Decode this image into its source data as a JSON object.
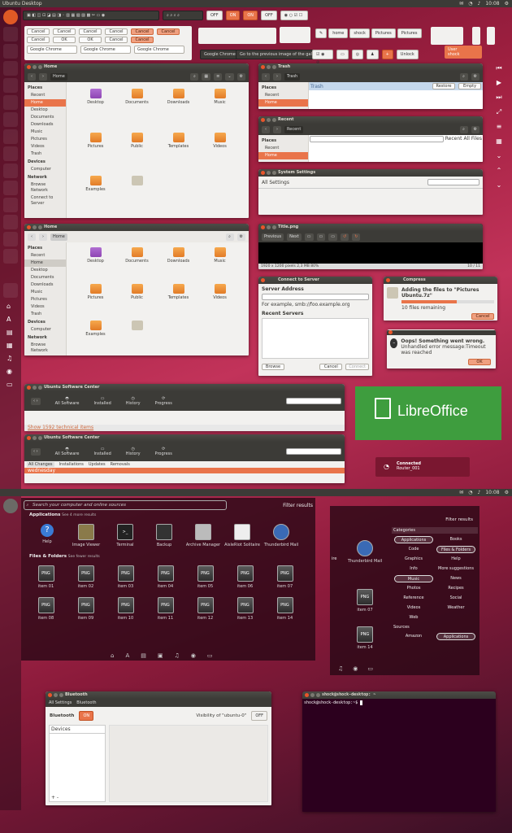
{
  "topbar": {
    "title": "Ubuntu Desktop",
    "time": "10:08"
  },
  "strip": {
    "off1": "OFF",
    "on1": "ON",
    "on2": "ON",
    "off2": "OFF"
  },
  "buttons": {
    "cancel": "Cancel",
    "ok": "OK",
    "select": "Google Chrome"
  },
  "tooltip": {
    "chrome": "Google Chrome",
    "prev": "Go to the previous image of the gallery"
  },
  "path": {
    "home": "home",
    "shock": "shock",
    "pictures": "Pictures",
    "pictures2": "Pictures"
  },
  "misc": {
    "unlock": "Unlock",
    "user": "User",
    "user_sub": "shock",
    "plus": "+"
  },
  "home1": {
    "title": "Home",
    "crumb": "Home"
  },
  "places": {
    "head": "Places",
    "items": [
      "Recent",
      "Home",
      "Desktop",
      "Documents",
      "Downloads",
      "Music",
      "Pictures",
      "Videos",
      "Trash"
    ],
    "devices": "Devices",
    "computer": "Computer",
    "network": "Network",
    "browse": "Browse Network",
    "connect": "Connect to Server"
  },
  "home_files": [
    "Desktop",
    "Documents",
    "Downloads",
    "Music",
    "Pictures",
    "Public",
    "Templates",
    "Videos",
    "Examples",
    ""
  ],
  "trash": {
    "title": "Trash",
    "crumb": "Trash",
    "row": "Trash",
    "restore": "Restore",
    "empty": "Empty"
  },
  "recent": {
    "title": "Recent",
    "crumb": "Recent",
    "recent_btn": "Recent",
    "allfiles": "All Files"
  },
  "settings": {
    "title": "System Settings",
    "all": "All Settings"
  },
  "home2": {
    "title": "Home",
    "crumb": "Home"
  },
  "viewer": {
    "title": "Title.png",
    "prev": "Previous",
    "next": "Next",
    "status": "1920 x 1200 pixels 2,3 MB   80%",
    "count": "10 / 11"
  },
  "connect": {
    "title": "Connect to Server",
    "addr": "Server Address",
    "example": "For example, smb://foo.example.org",
    "recentsrv": "Recent Servers",
    "browse": "Browse",
    "cancel": "Cancel",
    "connect": "Connect"
  },
  "compress": {
    "title": "Compress",
    "msg": "Adding the files to \"Pictures Ubuntu.7z\"",
    "remaining": "10 files remaining",
    "cancel": "Cancel",
    "progress": 0.6
  },
  "error": {
    "title": "Oops! Something went wrong.",
    "msg": "Unhandled error message:Timeout was reached",
    "ok": "OK"
  },
  "usc1": {
    "title": "Ubuntu Software Center",
    "all": "All Software",
    "installed": "Installed",
    "history": "History",
    "progress": "Progress",
    "link": "Show 1592 technical items"
  },
  "usc2": {
    "title": "Ubuntu Software Center",
    "all": "All Software",
    "installed": "Installed",
    "history": "History",
    "progress": "Progress",
    "tabs": [
      "All Changes",
      "Installations",
      "Updates",
      "Removals"
    ],
    "day": "wednesday"
  },
  "libre": {
    "text": "LibreOffice"
  },
  "net": {
    "name": "Connected",
    "sub": "Router_001"
  },
  "dash": {
    "search": "Search your computer and online sources",
    "filter": "Filter results",
    "apps": "Applications",
    "apps_more": "See 4 more results",
    "files": "Files & Folders",
    "files_more": "See fewer results",
    "app_items": [
      "Help",
      "Image Viewer",
      "Terminal",
      "Backup",
      "Archive Manager",
      "AisleRiot Solitaire",
      "Thunderbird Mail"
    ],
    "file_items": [
      "item 01",
      "item 02",
      "item 03",
      "item 04",
      "item 05",
      "item 06",
      "item 07",
      "item 08",
      "item 09",
      "item 10",
      "item 11",
      "item 12",
      "item 13",
      "item 14"
    ],
    "png": "PNG"
  },
  "filterpanel": {
    "filter": "Filter results",
    "categories": "Categories",
    "cats": [
      "Applications",
      "Books",
      "Code",
      "Files & Folders",
      "Graphics",
      "Help",
      "Info",
      "More suggestions",
      "Music",
      "News",
      "Photos",
      "Recipes",
      "Reference",
      "Social",
      "Videos",
      "Weather",
      "Web",
      ""
    ],
    "sources": "Sources",
    "amazon": "Amazon",
    "applications": "Applications",
    "tb": "Thunderbird Mail",
    "item07": "item 07",
    "item14": "item 14",
    "ire": "ire"
  },
  "bluetooth": {
    "title": "Bluetooth",
    "all": "All Settings",
    "crumb": "Bluetooth",
    "label": "Bluetooth",
    "on": "ON",
    "visibility": "Visibility of \"ubuntu-0\"",
    "off": "OFF",
    "devices": "Devices"
  },
  "terminal": {
    "title": "shock@shock-desktop: ~",
    "prompt": "shock@shock-desktop:~$"
  }
}
